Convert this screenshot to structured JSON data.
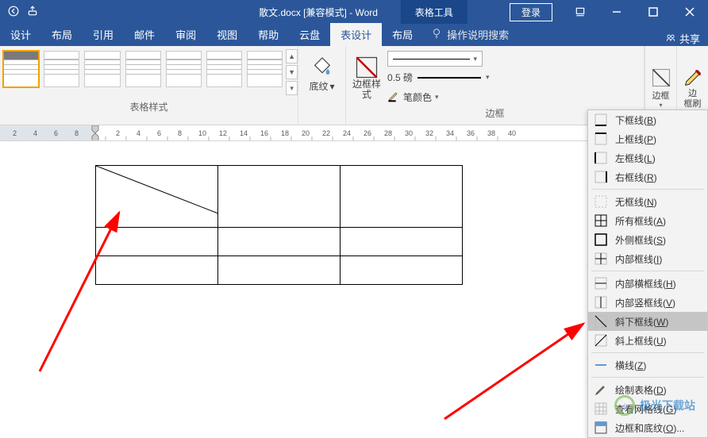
{
  "title": {
    "doc": "散文.docx [兼容模式] - Word",
    "tooltab": "表格工具",
    "login": "登录"
  },
  "tabs": {
    "t0": "设计",
    "t1": "布局",
    "t2": "引用",
    "t3": "邮件",
    "t4": "审阅",
    "t5": "视图",
    "t6": "帮助",
    "t7": "云盘",
    "t8": "表设计",
    "t9": "布局",
    "tell": "操作说明搜索",
    "share": "共享"
  },
  "groups": {
    "styles": "表格样式",
    "shading": "底纹",
    "borders": "边框",
    "border_style_btn": "边框样\n式",
    "weight_label": "0.5 磅",
    "pen_label": "笔颜色",
    "border_btn": "边框",
    "painter_btn": "边\n框刷"
  },
  "borders_menu": {
    "bottom": "下框线(B)",
    "top": "上框线(P)",
    "left": "左框线(L)",
    "right": "右框线(R)",
    "none": "无框线(N)",
    "all": "所有框线(A)",
    "outside": "外侧框线(S)",
    "inside": "内部框线(I)",
    "inside_h": "内部横框线(H)",
    "inside_v": "内部竖框线(V)",
    "diag_down": "斜下框线(W)",
    "diag_up": "斜上框线(U)",
    "hline": "横线(Z)",
    "draw": "绘制表格(D)",
    "grid": "查看网格线(G)",
    "dialog": "边框和底纹(O)..."
  },
  "ruler": {
    "marks": [
      2,
      4,
      6,
      8,
      10,
      12,
      14,
      16,
      18,
      20,
      22,
      24,
      26,
      28,
      30,
      32,
      34,
      36,
      38,
      40
    ]
  },
  "watermark": {
    "text": "极光下载站"
  }
}
